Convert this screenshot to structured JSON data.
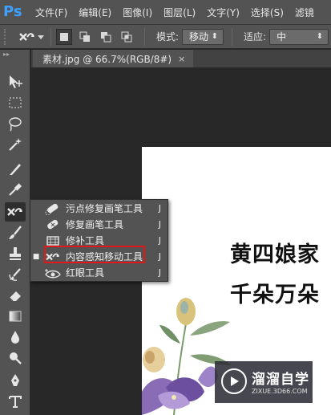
{
  "app": {
    "logo": "Ps"
  },
  "menu": [
    "文件(F)",
    "编辑(E)",
    "图像(I)",
    "图层(L)",
    "文字(Y)",
    "选择(S)",
    "滤镜"
  ],
  "options": {
    "mode_label": "模式:",
    "mode_value": "移动",
    "adapt_label": "适应:",
    "adapt_value": "中"
  },
  "document": {
    "tab_title": "素材.jpg @ 66.7%(RGB/8#)",
    "close": "×"
  },
  "flyout": {
    "items": [
      {
        "label": "污点修复画笔工具",
        "shortcut": "J",
        "icon": "spot-healing-brush-icon"
      },
      {
        "label": "修复画笔工具",
        "shortcut": "J",
        "icon": "healing-brush-icon"
      },
      {
        "label": "修补工具",
        "shortcut": "J",
        "icon": "patch-icon"
      },
      {
        "label": "内容感知移动工具",
        "shortcut": "J",
        "icon": "content-aware-move-icon",
        "selected": true
      },
      {
        "label": "红眼工具",
        "shortcut": "J",
        "icon": "red-eye-icon"
      }
    ]
  },
  "canvas": {
    "line1": "黄四娘家",
    "line2": "千朵万朵"
  },
  "watermark": {
    "title": "溜溜自学",
    "url": "ZIXUE.3D66.COM"
  },
  "colors": {
    "highlight": "#e01818",
    "ps_blue": "#3ea0ff",
    "panel": "#535353",
    "workspace": "#282828"
  }
}
